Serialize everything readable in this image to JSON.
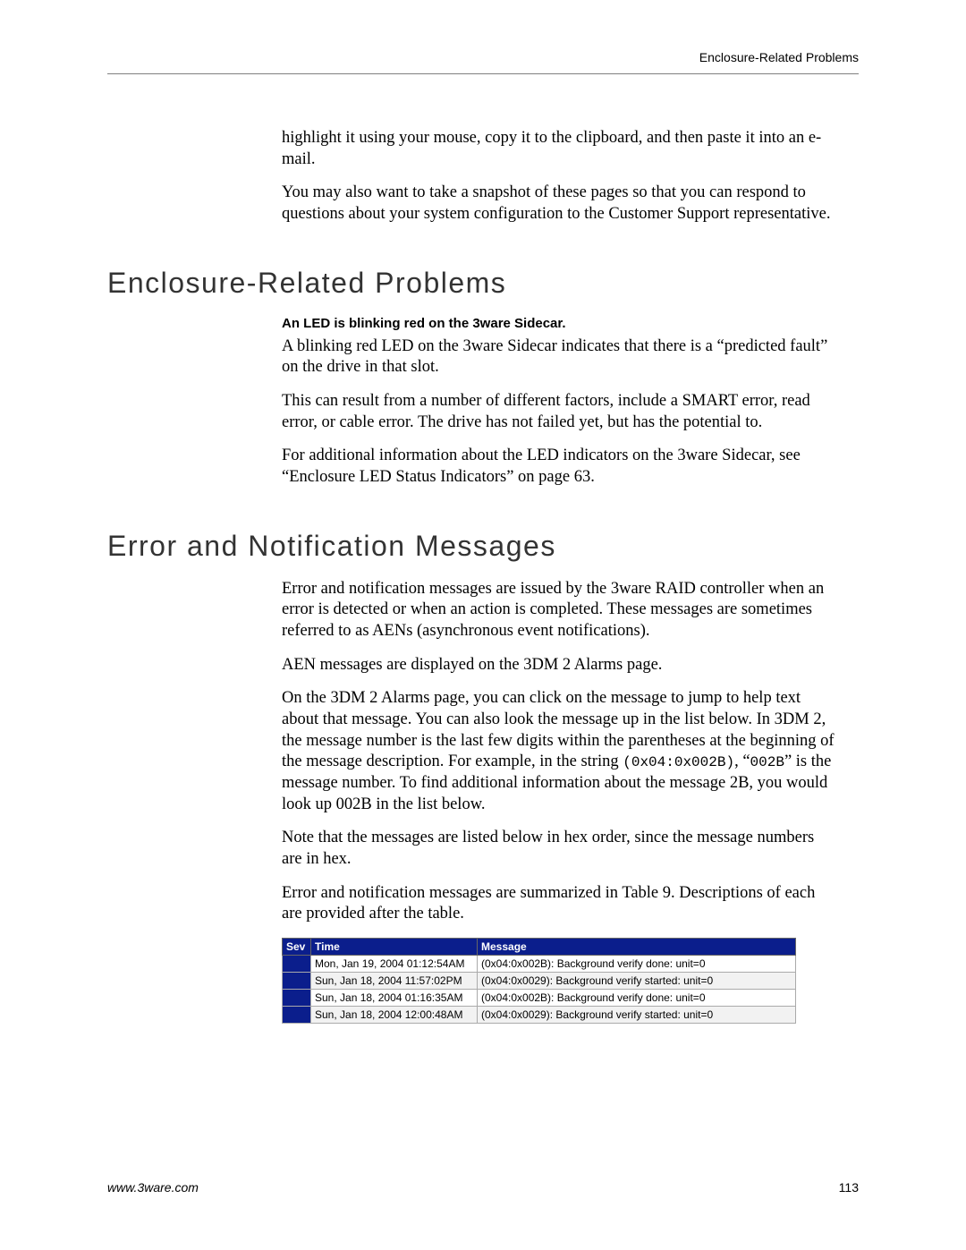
{
  "running_head": "Enclosure-Related Problems",
  "intro": {
    "p1": "highlight it using your mouse, copy it to the clipboard, and then paste it into an e-mail.",
    "p2": "You may also want to take a snapshot of these pages so that you can respond to questions about your system configuration to the Customer Support representative."
  },
  "section1": {
    "title": "Enclosure-Related Problems",
    "sub": "An LED is blinking red on the 3ware Sidecar.",
    "p1": "A blinking red LED on the 3ware Sidecar indicates that there is a “predicted fault” on the drive in that slot.",
    "p2": "This can result from a number of different factors, include a SMART error, read error, or cable error. The drive has not failed yet, but has the potential to.",
    "p3": "For additional information about the LED indicators on the 3ware Sidecar, see “Enclosure LED Status Indicators” on page 63."
  },
  "section2": {
    "title": "Error and Notification Messages",
    "p1": "Error and notification messages are issued by the 3ware RAID controller when an error is detected or when an action is completed. These messages are sometimes referred to as AENs (asynchronous event notifications).",
    "p2": "AEN messages are displayed on the 3DM 2 Alarms page.",
    "p3a": "On the 3DM 2 Alarms page, you can click on the message to jump to help text about that message. You can also look the message up in the list below. In 3DM 2, the message number is the last few digits within the parentheses at the beginning of the message description. For example, in the string ",
    "p3_code": "(0x04:0x002B)",
    "p3b": ", “",
    "p3_code2": "002B",
    "p3c": "” is the message number. To find additional information about the message 2B, you would look up 002B in the list below.",
    "p4": "Note that the messages are listed below in hex order, since the message numbers are in hex.",
    "p5": "Error and notification messages are summarized in Table 9. Descriptions of each are provided after the table."
  },
  "table": {
    "headers": {
      "sev": "Sev",
      "time": "Time",
      "message": "Message"
    },
    "rows": [
      {
        "time": "Mon, Jan 19, 2004 01:12:54AM",
        "message": "(0x04:0x002B): Background verify done: unit=0"
      },
      {
        "time": "Sun, Jan 18, 2004 11:57:02PM",
        "message": "(0x04:0x0029): Background verify started: unit=0"
      },
      {
        "time": "Sun, Jan 18, 2004 01:16:35AM",
        "message": "(0x04:0x002B): Background verify done: unit=0"
      },
      {
        "time": "Sun, Jan 18, 2004 12:00:48AM",
        "message": "(0x04:0x0029): Background verify started: unit=0"
      }
    ]
  },
  "footer": {
    "site": "www.3ware.com",
    "page": "113"
  }
}
